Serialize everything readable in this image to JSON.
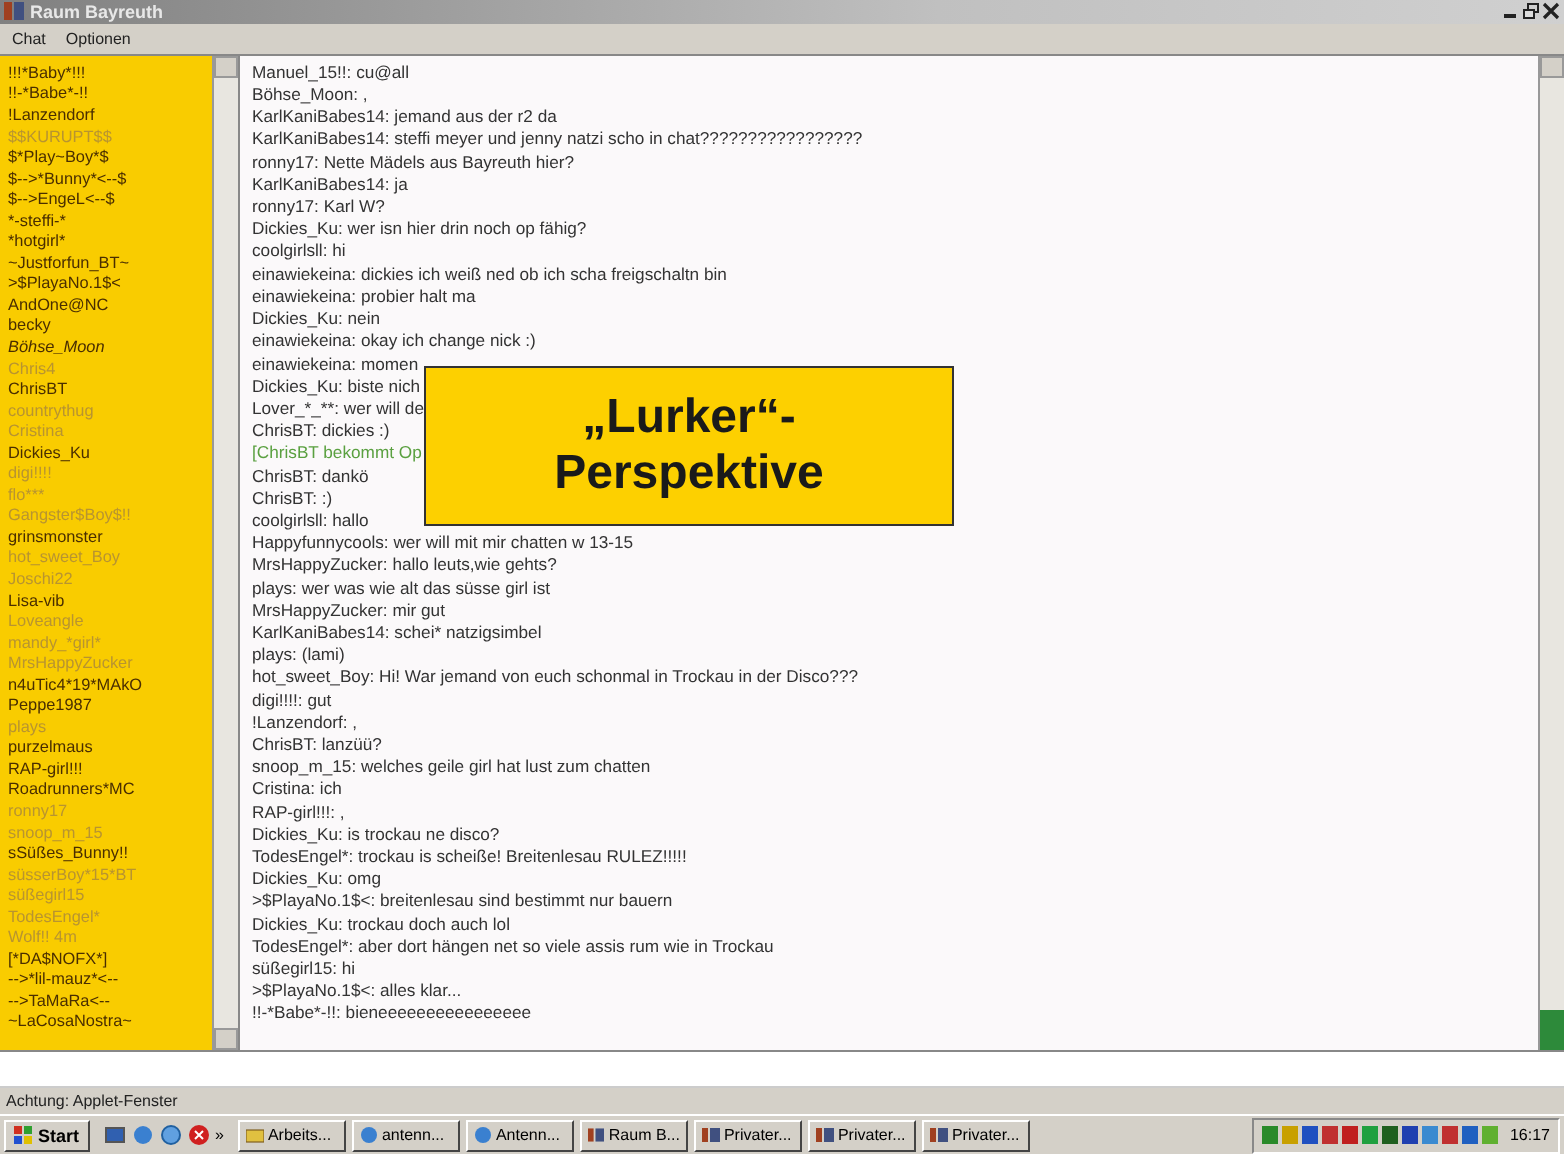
{
  "window": {
    "title": "Raum Bayreuth"
  },
  "menu": [
    "Chat",
    "Optionen"
  ],
  "users": [
    {
      "name": "!!!*Baby*!!!",
      "kind": "normal"
    },
    {
      "name": "!!-*Babe*-!!",
      "kind": "normal"
    },
    {
      "name": "!Lanzendorf",
      "kind": "normal"
    },
    {
      "name": "$$KURUPT$$",
      "kind": "away"
    },
    {
      "name": "$*Play~Boy*$",
      "kind": "normal"
    },
    {
      "name": "$-->*Bunny*<--$",
      "kind": "normal"
    },
    {
      "name": "$-->EngeL<--$",
      "kind": "normal"
    },
    {
      "name": "*-steffi-*",
      "kind": "normal"
    },
    {
      "name": "*hotgirl*",
      "kind": "normal"
    },
    {
      "name": "~Justforfun_BT~",
      "kind": "normal"
    },
    {
      "name": ">$PlayaNo.1$<",
      "kind": "normal"
    },
    {
      "name": "AndOne@NC",
      "kind": "normal"
    },
    {
      "name": "becky",
      "kind": "normal"
    },
    {
      "name": "Böhse_Moon",
      "kind": "self"
    },
    {
      "name": "Chris4",
      "kind": "away"
    },
    {
      "name": "ChrisBT",
      "kind": "normal"
    },
    {
      "name": "countrythug",
      "kind": "away"
    },
    {
      "name": "Cristina",
      "kind": "away"
    },
    {
      "name": "Dickies_Ku",
      "kind": "normal"
    },
    {
      "name": "digi!!!!",
      "kind": "away"
    },
    {
      "name": "flo***",
      "kind": "away"
    },
    {
      "name": "Gangster$Boy$!!",
      "kind": "away"
    },
    {
      "name": "grinsmonster",
      "kind": "normal"
    },
    {
      "name": "hot_sweet_Boy",
      "kind": "away"
    },
    {
      "name": "Joschi22",
      "kind": "away"
    },
    {
      "name": "Lisa-vib",
      "kind": "normal"
    },
    {
      "name": "Loveangle",
      "kind": "away"
    },
    {
      "name": "mandy_*girl*",
      "kind": "away"
    },
    {
      "name": "MrsHappyZucker",
      "kind": "away"
    },
    {
      "name": "n4uTic4*19*MAkO",
      "kind": "normal"
    },
    {
      "name": "Peppe1987",
      "kind": "normal"
    },
    {
      "name": "plays",
      "kind": "away"
    },
    {
      "name": "purzelmaus",
      "kind": "normal"
    },
    {
      "name": "RAP-girl!!!",
      "kind": "normal"
    },
    {
      "name": "Roadrunners*MC",
      "kind": "normal"
    },
    {
      "name": "ronny17",
      "kind": "away"
    },
    {
      "name": "snoop_m_15",
      "kind": "away"
    },
    {
      "name": "sSüßes_Bunny!!",
      "kind": "normal"
    },
    {
      "name": "süsserBoy*15*BT",
      "kind": "away"
    },
    {
      "name": "süßegirl15",
      "kind": "away"
    },
    {
      "name": "TodesEngel*",
      "kind": "away"
    },
    {
      "name": "Wolf!! 4m",
      "kind": "away"
    },
    {
      "name": "[*DA$NOFX*]",
      "kind": "normal"
    },
    {
      "name": "-->*lil-mauz*<--",
      "kind": "normal"
    },
    {
      "name": "-->TaMaRa<--",
      "kind": "normal"
    },
    {
      "name": "~LaCosaNostra~",
      "kind": "normal"
    }
  ],
  "chat": [
    {
      "text": "Manuel_15!!: cu@all",
      "kind": "message"
    },
    {
      "text": "Böhse_Moon: ,",
      "kind": "message"
    },
    {
      "text": "KarlKaniBabes14: jemand aus der r2 da",
      "kind": "message"
    },
    {
      "text": "KarlKaniBabes14: steffi meyer und jenny natzi scho in chat?????????????????",
      "kind": "message"
    },
    {
      "text": "ronny17: Nette Mädels aus Bayreuth hier?",
      "kind": "message"
    },
    {
      "text": "KarlKaniBabes14: ja",
      "kind": "message"
    },
    {
      "text": "ronny17: Karl W?",
      "kind": "message"
    },
    {
      "text": "Dickies_Ku: wer isn hier drin noch op fähig?",
      "kind": "message"
    },
    {
      "text": "coolgirlsll: hi",
      "kind": "message"
    },
    {
      "text": "einawiekeina: dickies ich weiß ned ob ich scha freigschaltn bin",
      "kind": "message"
    },
    {
      "text": "einawiekeina: probier halt ma",
      "kind": "message"
    },
    {
      "text": "Dickies_Ku: nein",
      "kind": "message"
    },
    {
      "text": "einawiekeina: okay ich change nick :)",
      "kind": "message"
    },
    {
      "text": "einawiekeina: momen",
      "kind": "message"
    },
    {
      "text": "Dickies_Ku: biste nich",
      "kind": "message"
    },
    {
      "text": "Lover_*_**: wer will de",
      "kind": "message"
    },
    {
      "text": "ChrisBT: dickies :)",
      "kind": "message"
    },
    {
      "text": "[ChrisBT bekommt Op",
      "kind": "system"
    },
    {
      "text": "ChrisBT: dankö",
      "kind": "message"
    },
    {
      "text": "ChrisBT: :)",
      "kind": "message"
    },
    {
      "text": "coolgirlsll: hallo",
      "kind": "message"
    },
    {
      "text": "Happyfunnycools: wer will mit mir chatten w 13-15",
      "kind": "message"
    },
    {
      "text": "MrsHappyZucker: hallo leuts,wie gehts?",
      "kind": "message"
    },
    {
      "text": "plays: wer was wie alt das süsse girl ist",
      "kind": "message"
    },
    {
      "text": "MrsHappyZucker: mir gut",
      "kind": "message"
    },
    {
      "text": "KarlKaniBabes14: schei* natzigsimbel",
      "kind": "message"
    },
    {
      "text": "plays: (lami)",
      "kind": "message"
    },
    {
      "text": "hot_sweet_Boy: Hi! War jemand von euch schonmal in Trockau in der Disco???",
      "kind": "message"
    },
    {
      "text": "digi!!!!: gut",
      "kind": "message"
    },
    {
      "text": "!Lanzendorf: ,",
      "kind": "message"
    },
    {
      "text": "ChrisBT: lanzüü?",
      "kind": "message"
    },
    {
      "text": "snoop_m_15: welches geile girl hat lust zum chatten",
      "kind": "message"
    },
    {
      "text": "Cristina: ich",
      "kind": "message"
    },
    {
      "text": "RAP-girl!!!: ,",
      "kind": "message"
    },
    {
      "text": "Dickies_Ku: is trockau ne disco?",
      "kind": "message"
    },
    {
      "text": "TodesEngel*: trockau is scheiße! Breitenlesau RULEZ!!!!!",
      "kind": "message"
    },
    {
      "text": "Dickies_Ku: omg",
      "kind": "message"
    },
    {
      "text": ">$PlayaNo.1$<: breitenlesau sind bestimmt nur bauern",
      "kind": "message"
    },
    {
      "text": "Dickies_Ku: trockau doch auch lol",
      "kind": "message"
    },
    {
      "text": "TodesEngel*: aber dort hängen net so viele assis rum wie in Trockau",
      "kind": "message"
    },
    {
      "text": "süßegirl15: hi",
      "kind": "message"
    },
    {
      "text": ">$PlayaNo.1$<: alles klar...",
      "kind": "message"
    },
    {
      "text": "!!-*Babe*-!!: bieneeeeeeeeeeeeeeee",
      "kind": "message"
    }
  ],
  "overlay": {
    "lines": [
      "„Lurker“-",
      "Perspektive"
    ]
  },
  "status_bar": "Achtung: Applet-Fenster",
  "taskbar": {
    "start": "Start",
    "tasks": [
      {
        "label": "Arbeits...",
        "kind": "folder"
      },
      {
        "label": "antenn...",
        "kind": "browser"
      },
      {
        "label": "Antenn...",
        "kind": "browser"
      },
      {
        "label": "Raum B...",
        "kind": "applet"
      },
      {
        "label": "Privater...",
        "kind": "applet"
      },
      {
        "label": "Privater...",
        "kind": "applet"
      },
      {
        "label": "Privater...",
        "kind": "applet"
      }
    ],
    "more": "»",
    "clock": "16:17"
  }
}
